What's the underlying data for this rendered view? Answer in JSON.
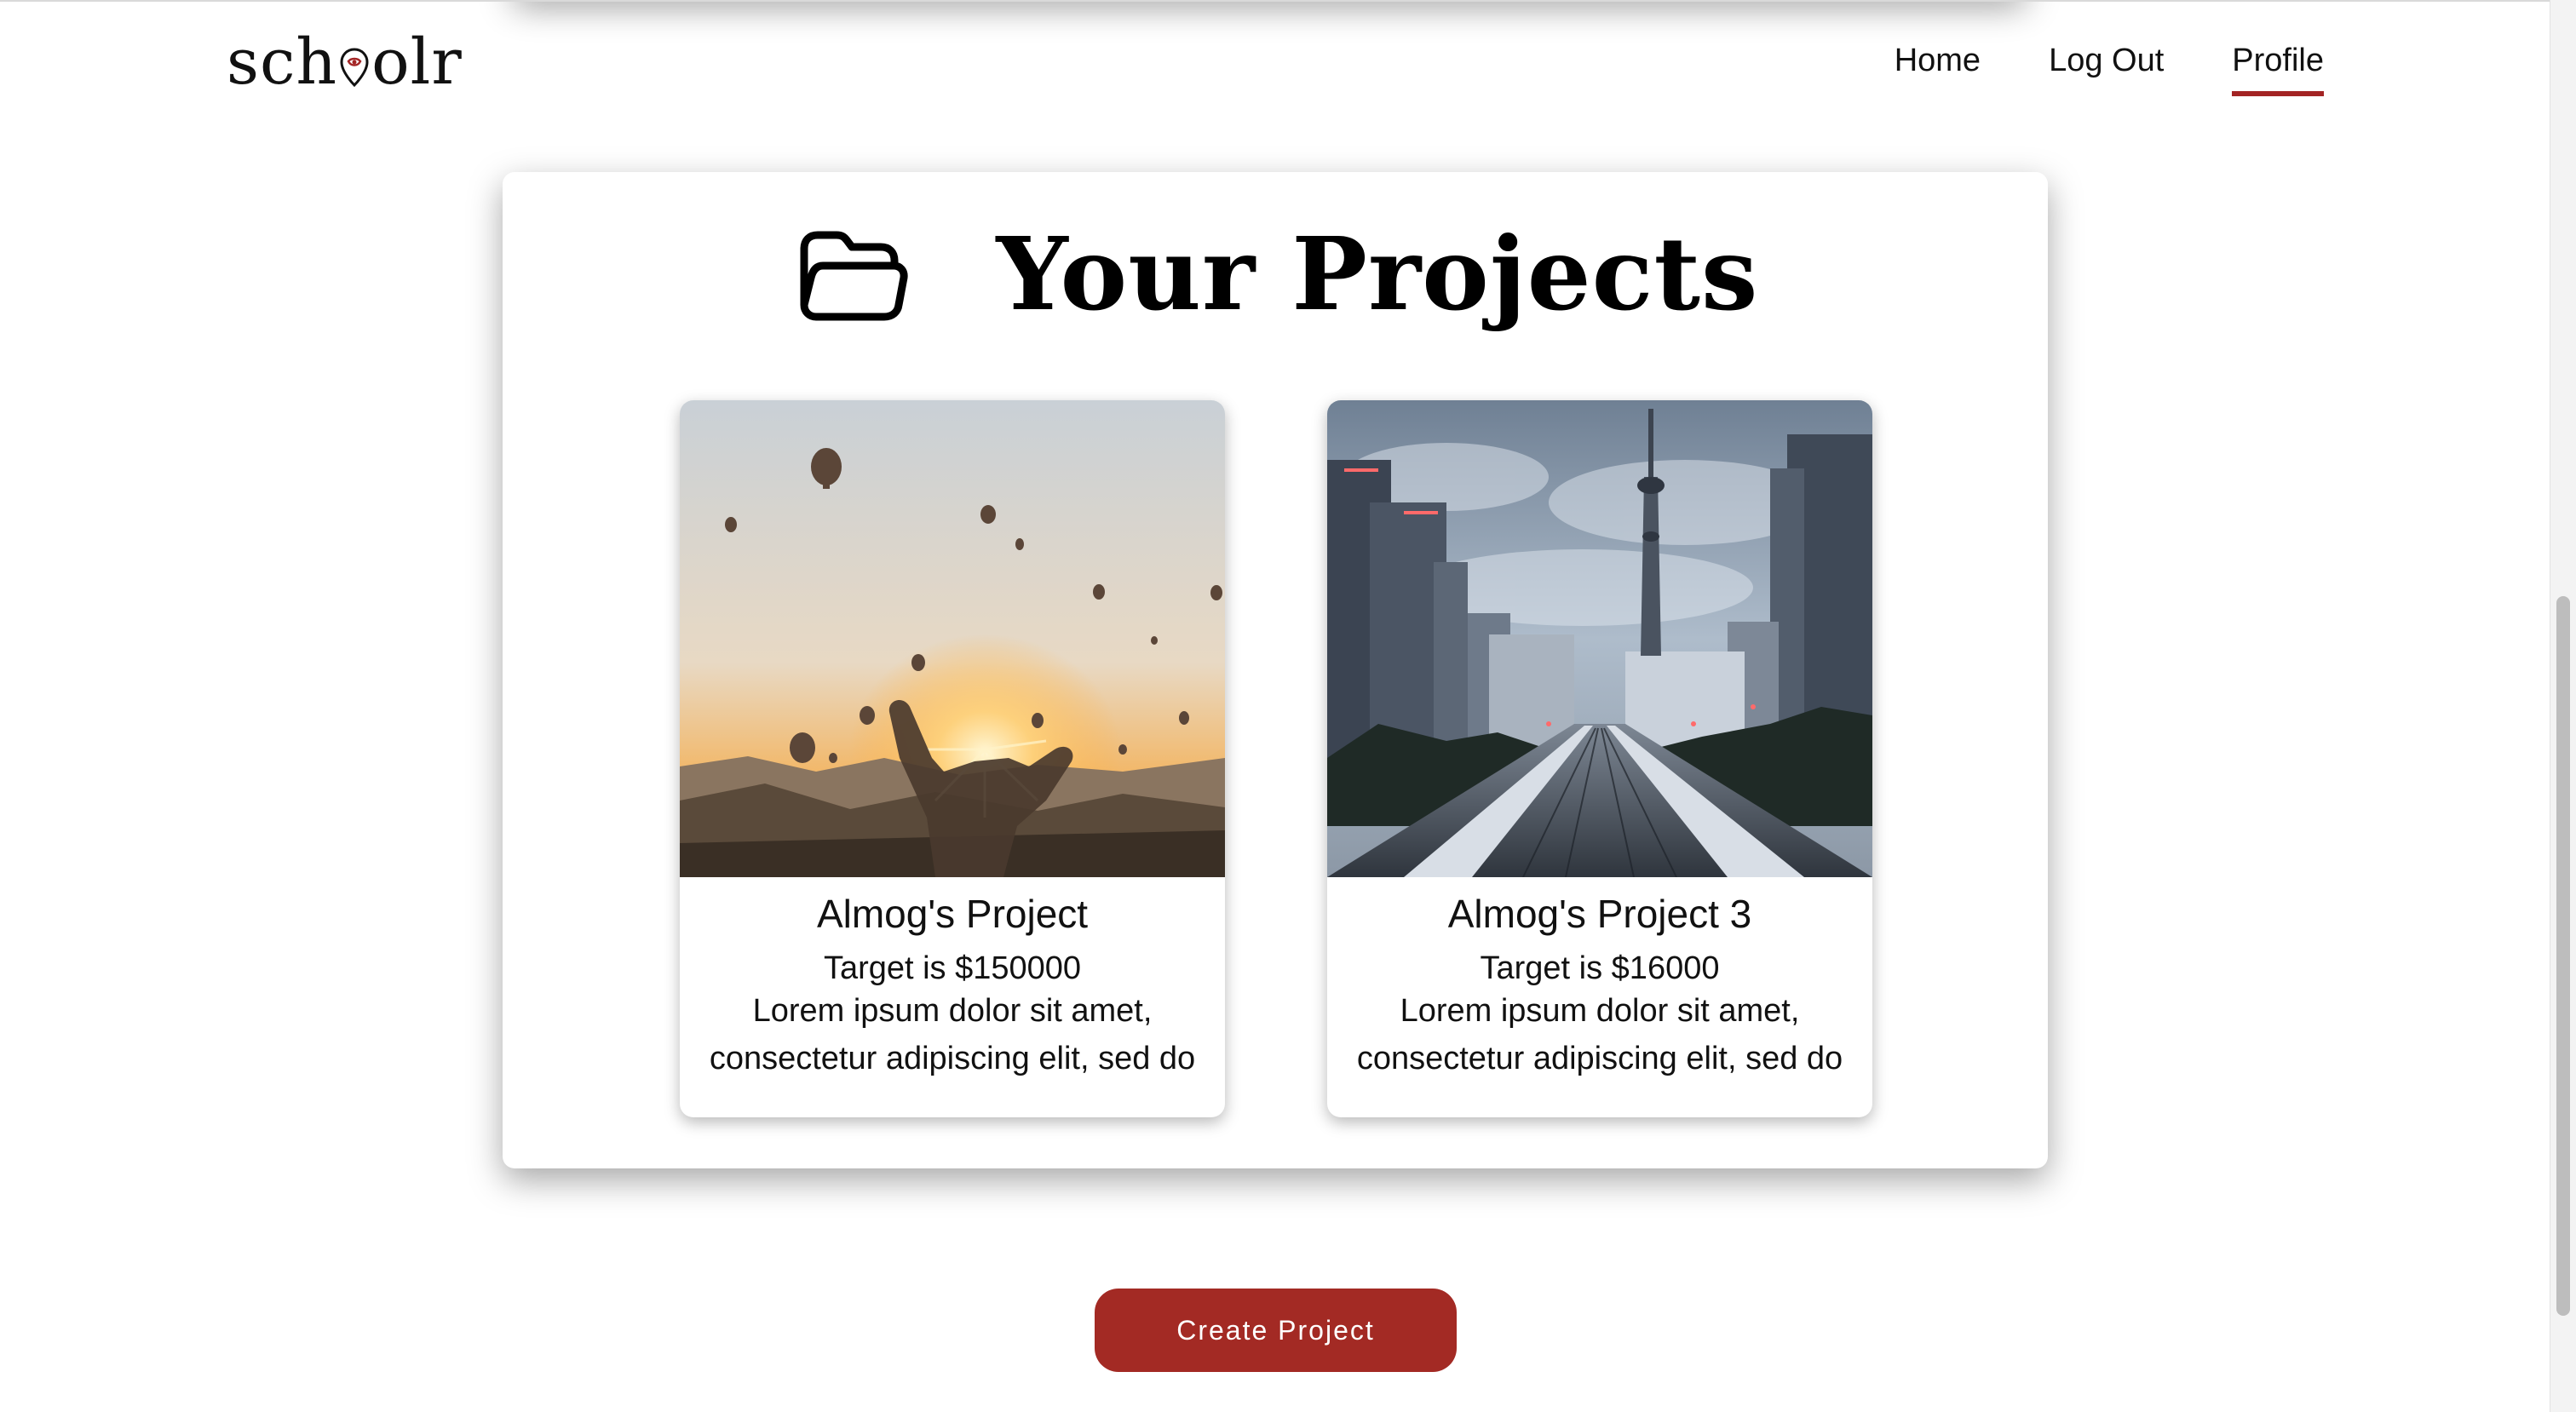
{
  "brand": {
    "logo_left": "sch",
    "logo_right": "olr",
    "accent_color": "#a32424"
  },
  "nav": {
    "items": [
      {
        "label": "Home",
        "active": false
      },
      {
        "label": "Log Out",
        "active": false
      },
      {
        "label": "Profile",
        "active": true
      }
    ]
  },
  "projects": {
    "title": "Your Projects",
    "icon": "folder-icon",
    "cards": [
      {
        "title": "Almog's Project",
        "target": "Target is $150000",
        "desc_line1": "Lorem ipsum dolor sit amet,",
        "desc_line2": "consectetur adipiscing elit, sed do",
        "image": "hot-air-balloons-sunset-photo"
      },
      {
        "title": "Almog's Project 3",
        "target": "Target is $16000",
        "desc_line1": "Lorem ipsum dolor sit amet,",
        "desc_line2": "consectetur adipiscing elit, sed do",
        "image": "city-tower-railway-photo"
      }
    ]
  },
  "actions": {
    "create_label": "Create Project",
    "create_color": "#a32a24"
  }
}
